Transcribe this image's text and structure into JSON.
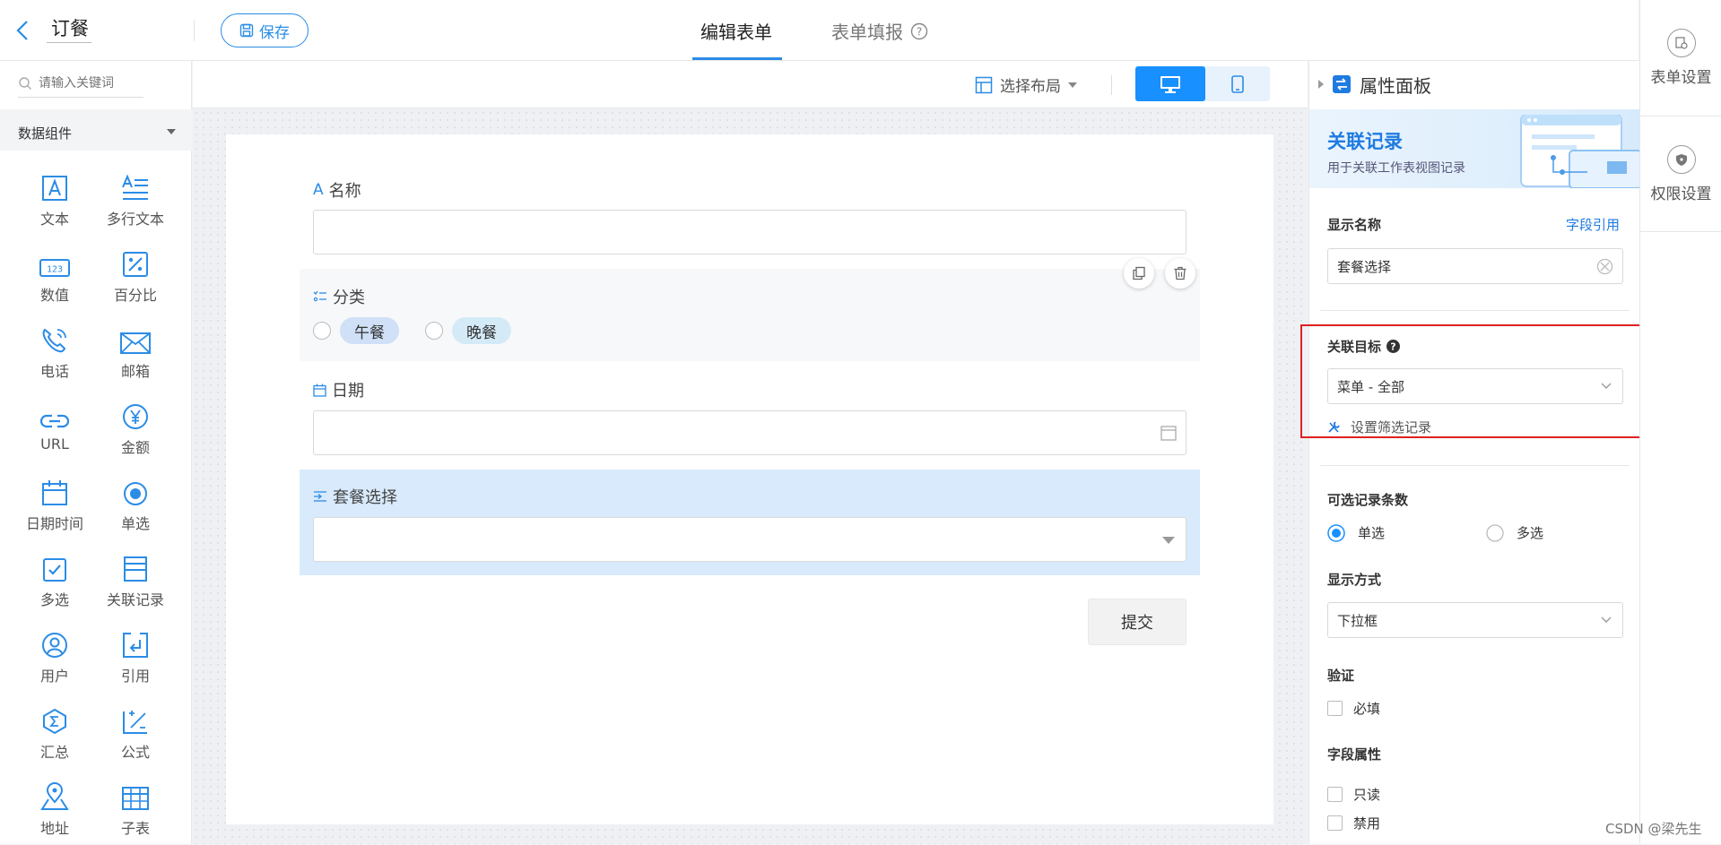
{
  "header": {
    "title": "订餐",
    "save_label": "保存",
    "tabs": [
      {
        "label": "编辑表单"
      },
      {
        "label": "表单填报"
      }
    ]
  },
  "left_panel": {
    "search_placeholder": "请输入关键词",
    "group_label": "数据组件",
    "components": [
      {
        "label": "文本",
        "icon": "text-icon"
      },
      {
        "label": "多行文本",
        "icon": "multiline-text-icon"
      },
      {
        "label": "数值",
        "icon": "number-icon"
      },
      {
        "label": "百分比",
        "icon": "percent-icon"
      },
      {
        "label": "电话",
        "icon": "phone-icon"
      },
      {
        "label": "邮箱",
        "icon": "mail-icon"
      },
      {
        "label": "URL",
        "icon": "link-icon"
      },
      {
        "label": "金额",
        "icon": "yen-icon"
      },
      {
        "label": "日期时间",
        "icon": "calendar-icon"
      },
      {
        "label": "单选",
        "icon": "radio-icon"
      },
      {
        "label": "多选",
        "icon": "checkbox-icon"
      },
      {
        "label": "关联记录",
        "icon": "related-record-icon"
      },
      {
        "label": "用户",
        "icon": "user-icon"
      },
      {
        "label": "引用",
        "icon": "reference-icon"
      },
      {
        "label": "汇总",
        "icon": "sum-icon"
      },
      {
        "label": "公式",
        "icon": "formula-icon"
      },
      {
        "label": "地址",
        "icon": "location-icon"
      },
      {
        "label": "子表",
        "icon": "subtable-icon"
      }
    ]
  },
  "toolbar": {
    "layout_label": "选择布局"
  },
  "form": {
    "fields": {
      "name": {
        "label": "名称"
      },
      "category": {
        "label": "分类",
        "options": [
          "午餐",
          "晚餐"
        ]
      },
      "date": {
        "label": "日期"
      },
      "package": {
        "label": "套餐选择"
      }
    },
    "submit_label": "提交"
  },
  "right_panel": {
    "header_label": "属性面板",
    "banner_title": "关联记录",
    "banner_subtitle": "用于关联工作表视图记录",
    "display_name_label": "显示名称",
    "field_ref_link": "字段引用",
    "display_name_value": "套餐选择",
    "target_label": "关联目标",
    "target_value": "菜单 - 全部",
    "filter_link": "设置筛选记录",
    "count_label": "可选记录条数",
    "count_options": [
      "单选",
      "多选"
    ],
    "display_mode_label": "显示方式",
    "display_mode_value": "下拉框",
    "validation_label": "验证",
    "required_label": "必填",
    "field_props_label": "字段属性",
    "readonly_label": "只读",
    "disabled_label": "禁用"
  },
  "far_right": {
    "items": [
      {
        "label": "表单设置"
      },
      {
        "label": "权限设置"
      }
    ]
  },
  "watermark": "CSDN @梁先生",
  "colors": {
    "accent": "#1890ff",
    "highlight": "#e02020"
  }
}
